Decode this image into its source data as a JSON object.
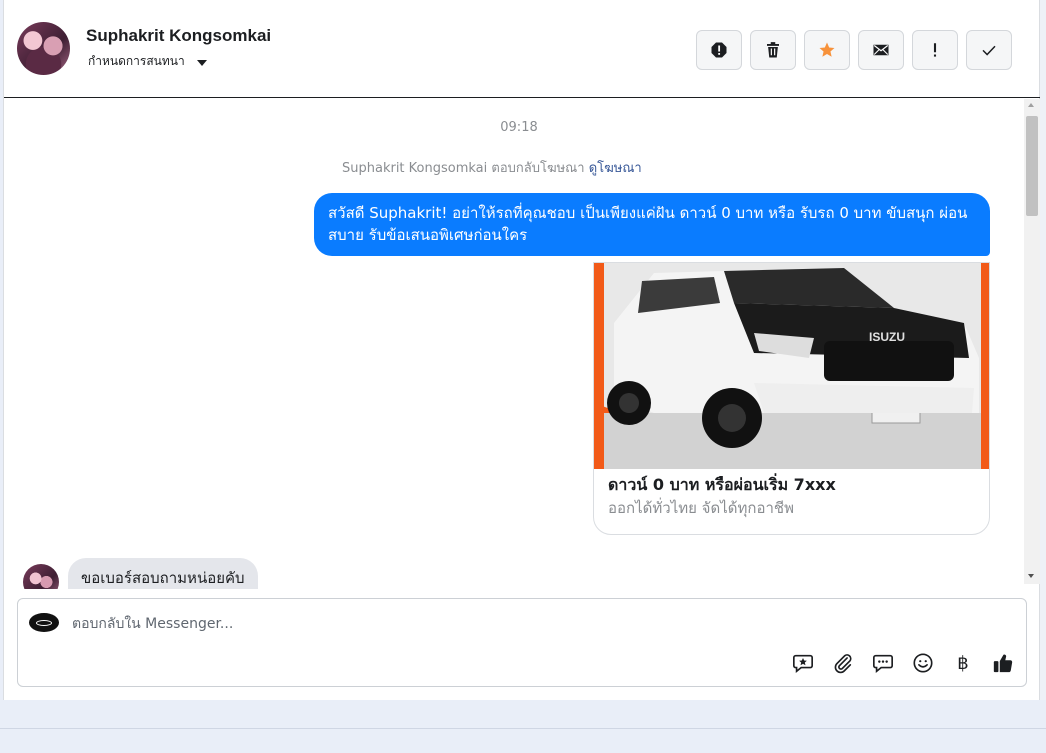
{
  "header": {
    "contact_name": "Suphakrit Kongsomkai",
    "conversation_settings_label": "กำหนดการสนทนา",
    "actions": [
      {
        "name": "report-spam-button",
        "icon": "alert-octagon-icon"
      },
      {
        "name": "delete-button",
        "icon": "trash-icon"
      },
      {
        "name": "star-button",
        "icon": "star-icon",
        "color": "#f7923b"
      },
      {
        "name": "mark-unread-button",
        "icon": "envelope-icon"
      },
      {
        "name": "mark-important-button",
        "icon": "exclamation-icon"
      },
      {
        "name": "mark-done-button",
        "icon": "checkmark-icon"
      }
    ]
  },
  "conversation": {
    "timestamp": "09:18",
    "reply_note_text": "Suphakrit Kongsomkai ตอบกลับโฆษณา",
    "reply_note_link": "ดูโฆษณา",
    "outgoing_message": "สวัสดี Suphakrit! อย่าให้รถที่คุณชอบ เป็นเพียงแค่ฝัน ดาวน์ 0 บาท หรือ รับรถ 0 บาท ขับสนุก ผ่อนสบาย รับข้อเสนอพิเศษก่อนใคร",
    "ad_card": {
      "image_text": "ISUZU",
      "title": "ดาวน์ 0 บาท หรือผ่อนเริ่ม 7xxx",
      "subtitle": "ออกได้ทั่วไทย จัดได้ทุกอาชีพ"
    },
    "incoming_message": "ขอเบอร์สอบถามหน่อยคับ"
  },
  "composer": {
    "placeholder": "ตอบกลับใน Messenger...",
    "baht_symbol": "฿",
    "tools": [
      "saved-reply-icon",
      "attachment-icon",
      "chat-bubble-icon",
      "emoji-icon",
      "baht-icon",
      "thumbs-up-icon"
    ]
  },
  "colors": {
    "outgoing_bubble": "#0a7cff",
    "incoming_bubble": "#e4e6eb",
    "link": "#385898",
    "star_accent": "#f7923b"
  }
}
